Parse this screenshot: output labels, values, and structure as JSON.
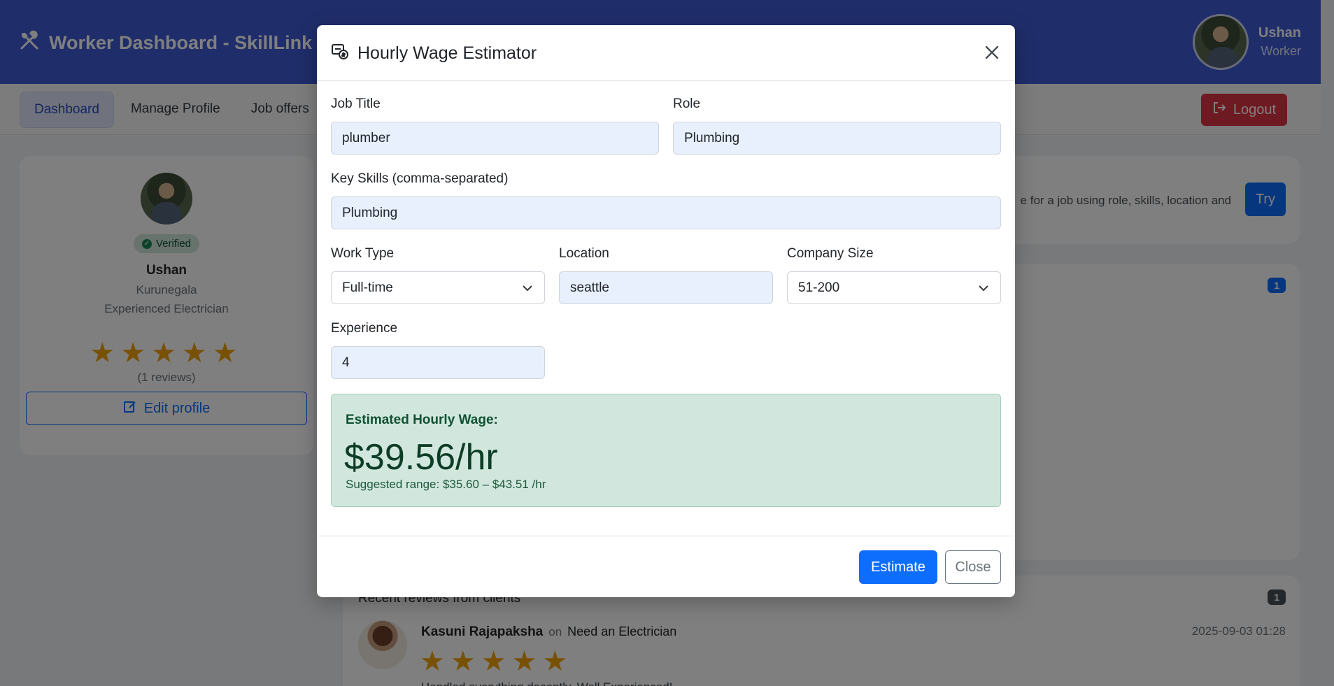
{
  "header": {
    "title": "Worker Dashboard - SkillLink",
    "brand_icon": "tools-icon",
    "user_name": "Ushan",
    "user_role": "Worker"
  },
  "nav": {
    "items": [
      {
        "label": "Dashboard"
      },
      {
        "label": "Manage Profile"
      },
      {
        "label": "Job offers"
      }
    ],
    "logout_label": "Logout"
  },
  "profile": {
    "verified_label": "Verified",
    "name": "Ushan",
    "location": "Kurunegala",
    "title": "Experienced Electrician",
    "rating": 5,
    "reviews_count": "(1 reviews)",
    "edit_label": "Edit profile"
  },
  "try_card": {
    "text": "e for a job using role, skills, location and",
    "button_label": "Try"
  },
  "job_offers_badge": "1",
  "reviews": {
    "title": "Recent reviews from clients",
    "badge": "1",
    "items": [
      {
        "reviewer": "Kasuni Rajapaksha",
        "on_label": "on",
        "job": "Need an Electrician",
        "date": "2025-09-03 01:28",
        "rating": 5,
        "text": "Handled everything decently. Well Experienced!"
      }
    ]
  },
  "modal": {
    "title": "Hourly Wage Estimator",
    "job_title_label": "Job Title",
    "job_title_value": "plumber",
    "role_label": "Role",
    "role_value": "Plumbing",
    "skills_label": "Key Skills (comma-separated)",
    "skills_value": "Plumbing",
    "work_type_label": "Work Type",
    "work_type_value": "Full-time",
    "location_label": "Location",
    "location_value": "seattle",
    "company_size_label": "Company Size",
    "company_size_value": "51-200",
    "experience_label": "Experience",
    "experience_value": "4",
    "result_label": "Estimated Hourly Wage:",
    "result_value": "$39.56/hr",
    "result_range": "Suggested range: $35.60 – $43.51 /hr",
    "estimate_label": "Estimate",
    "close_label": "Close"
  },
  "colors": {
    "header_bg": "#3f5bd4",
    "primary": "#0d6efd",
    "danger": "#dc3545",
    "success_bg": "#d1e7dd",
    "star": "#f0a30a"
  }
}
